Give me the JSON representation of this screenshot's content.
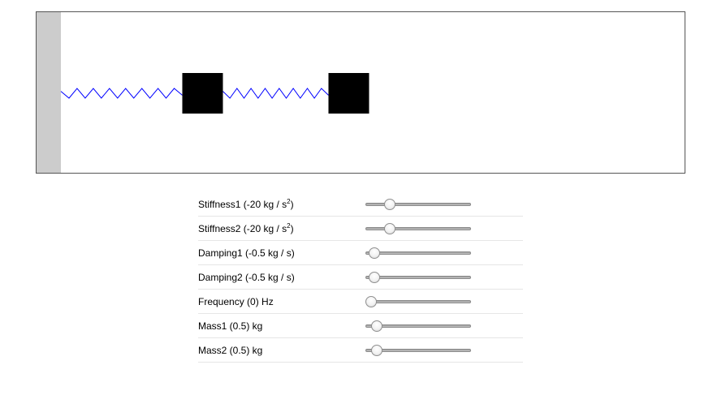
{
  "colors": {
    "spring": "#0000ff",
    "mass": "#000000",
    "wall": "#cccccc"
  },
  "simulation": {
    "mass1_position": 0.2556,
    "mass2_position": 0.4806
  },
  "controls": [
    {
      "id": "stiffness1",
      "label": "Stiffness1 (-20 kg / s",
      "sup": "2",
      "suffix": ")",
      "value": 0.2308
    },
    {
      "id": "stiffness2",
      "label": "Stiffness2 (-20 kg / s",
      "sup": "2",
      "suffix": ")",
      "value": 0.2308
    },
    {
      "id": "damping1",
      "label": "Damping1 (-0.5 kg / s)",
      "sup": "",
      "suffix": "",
      "value": 0.0846
    },
    {
      "id": "damping2",
      "label": "Damping2 (-0.5 kg / s)",
      "sup": "",
      "suffix": "",
      "value": 0.0846
    },
    {
      "id": "frequency",
      "label": "Frequency (0) Hz",
      "sup": "",
      "suffix": "",
      "value": 0.0538
    },
    {
      "id": "mass1",
      "label": "Mass1 (0.5) kg",
      "sup": "",
      "suffix": "",
      "value": 0.1077
    },
    {
      "id": "mass2",
      "label": "Mass2 (0.5) kg",
      "sup": "",
      "suffix": "",
      "value": 0.1077
    }
  ]
}
